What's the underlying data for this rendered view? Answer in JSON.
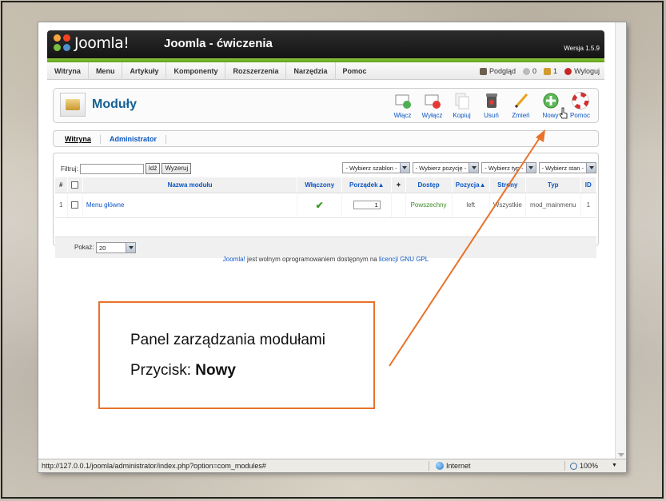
{
  "browser": {
    "status_url": "http://127.0.0.1/joomla/administrator/index.php?option=com_modules#",
    "zone": "Internet",
    "zoom": "100%"
  },
  "joomla": {
    "logo_text": "Joomla!",
    "site_name": "Joomla - ćwiczenia",
    "version": "Wersja 1.5.9",
    "menu": [
      "Witryna",
      "Menu",
      "Artykuły",
      "Komponenty",
      "Rozszerzenia",
      "Narzędzia",
      "Pomoc"
    ],
    "status": {
      "preview": "Podgląd",
      "messages": "0",
      "users": "1",
      "logout": "Wyloguj"
    },
    "page_title": "Moduły",
    "toolbar": {
      "enable": "Włącz",
      "disable": "Wyłącz",
      "copy": "Kopiuj",
      "delete": "Usuń",
      "edit": "Zmień",
      "new": "Nowy",
      "help": "Pomoc"
    },
    "submenu": [
      "Witryna",
      "Administrator"
    ],
    "filter_label": "Filtruj:",
    "filter_value": "",
    "go_button": "Idź",
    "reset_button": "Wyzeruj",
    "selects": [
      "- Wybierz szablon -",
      "- Wybierz pozycję -",
      "- Wybierz typ -",
      "- Wybierz stan -"
    ],
    "columns": [
      "#",
      "",
      "Nazwa modułu",
      "Włączony",
      "Porządek",
      "",
      "Dostęp",
      "Pozycja",
      "Strony",
      "Typ",
      "ID"
    ],
    "rows": [
      {
        "num": "1",
        "name": "Menu główne",
        "enabled": "✔",
        "order": "1",
        "access": "Powszechny",
        "position": "left",
        "pages": "Wszystkie",
        "type": "mod_mainmenu",
        "id": "1"
      }
    ],
    "pager_label": "Pokaż:",
    "pager_value": "20",
    "footer": {
      "link1": "Joomla!",
      "text": " jest wolnym oprogramowaniem dostępnym na ",
      "link2": "licencji GNU GPL"
    }
  },
  "annotation": {
    "line1": "Panel zarządzania modułami",
    "line2_prefix": "Przycisk: ",
    "line2_bold": "Nowy"
  },
  "colors": {
    "accent_orange": "#e8722a",
    "joomla_green": "#7ab82d",
    "link_blue": "#0b55c4",
    "title_blue": "#146295"
  }
}
